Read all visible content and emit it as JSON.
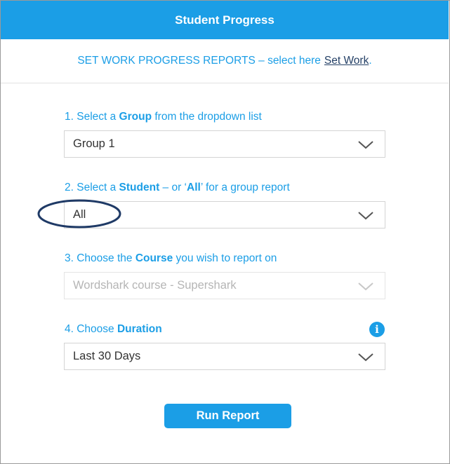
{
  "header": {
    "title": "Student Progress"
  },
  "set_work": {
    "text": "SET WORK PROGRESS REPORTS – select here",
    "link": "Set Work",
    "trailing": "."
  },
  "steps": [
    {
      "label_pre": "1. Select a ",
      "label_bold": "Group",
      "label_post": " from the dropdown list",
      "value": "Group 1",
      "disabled": false
    },
    {
      "label_pre": "2. Select a ",
      "label_bold": "Student",
      "label_mid": " – or ‘",
      "label_bold2": "All",
      "label_post": "’ for a group report",
      "value": "All",
      "disabled": false
    },
    {
      "label_pre": "3. Choose the ",
      "label_bold": "Course",
      "label_post": " you wish to report on",
      "value": "Wordshark course - Supershark",
      "disabled": true
    },
    {
      "label_pre": "4. Choose ",
      "label_bold": "Duration",
      "label_post": "",
      "value": "Last 30 Days",
      "disabled": false
    }
  ],
  "info_icon": {
    "glyph": "i"
  },
  "run_button": {
    "label": "Run Report"
  },
  "colors": {
    "accent": "#1b9ee6",
    "link": "#244066",
    "annotation": "#1f3a66"
  },
  "icons": [
    "chevron-down-icon",
    "info-icon"
  ]
}
